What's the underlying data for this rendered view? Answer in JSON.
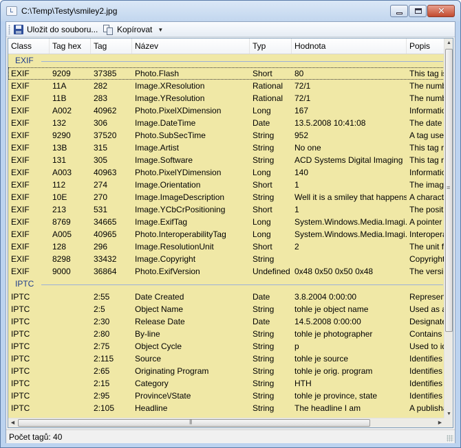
{
  "window": {
    "title": "C:\\Temp\\Testy\\smiley2.jpg"
  },
  "toolbar": {
    "save_label": "Uložit do souboru...",
    "copy_label": "Kopírovat"
  },
  "columns": [
    "Class",
    "Tag hex",
    "Tag",
    "Název",
    "Typ",
    "Hodnota",
    "Popis"
  ],
  "groups": [
    {
      "name": "EXIF",
      "rows": [
        [
          "EXIF",
          "9209",
          "37385",
          "Photo.Flash",
          "Short",
          "80",
          "This tag is"
        ],
        [
          "EXIF",
          "11A",
          "282",
          "Image.XResolution",
          "Rational",
          "72/1",
          "The numbe"
        ],
        [
          "EXIF",
          "11B",
          "283",
          "Image.YResolution",
          "Rational",
          "72/1",
          "The numbe"
        ],
        [
          "EXIF",
          "A002",
          "40962",
          "Photo.PixelXDimension",
          "Long",
          "167",
          "Information"
        ],
        [
          "EXIF",
          "132",
          "306",
          "Image.DateTime",
          "Date",
          "13.5.2008 10:41:08",
          "The date a"
        ],
        [
          "EXIF",
          "9290",
          "37520",
          "Photo.SubSecTime",
          "String",
          "952",
          "A tag used"
        ],
        [
          "EXIF",
          "13B",
          "315",
          "Image.Artist",
          "String",
          "No one",
          "This tag re"
        ],
        [
          "EXIF",
          "131",
          "305",
          "Image.Software",
          "String",
          "ACD Systems Digital Imaging",
          "This tag re"
        ],
        [
          "EXIF",
          "A003",
          "40963",
          "Photo.PixelYDimension",
          "Long",
          "140",
          "Information"
        ],
        [
          "EXIF",
          "112",
          "274",
          "Image.Orientation",
          "Short",
          "1",
          "The image"
        ],
        [
          "EXIF",
          "10E",
          "270",
          "Image.ImageDescription",
          "String",
          "Well it is a smiley that happens...",
          "A characte"
        ],
        [
          "EXIF",
          "213",
          "531",
          "Image.YCbCrPositioning",
          "Short",
          "1",
          "The positio"
        ],
        [
          "EXIF",
          "8769",
          "34665",
          "Image.ExifTag",
          "Long",
          "System.Windows.Media.Imagi...",
          "A pointer to"
        ],
        [
          "EXIF",
          "A005",
          "40965",
          "Photo.InteroperabilityTag",
          "Long",
          "System.Windows.Media.Imagi...",
          "Interopera"
        ],
        [
          "EXIF",
          "128",
          "296",
          "Image.ResolutionUnit",
          "Short",
          "2",
          "The unit fo"
        ],
        [
          "EXIF",
          "8298",
          "33432",
          "Image.Copyright",
          "String",
          "",
          "Copyright i"
        ],
        [
          "EXIF",
          "9000",
          "36864",
          "Photo.ExifVersion",
          "Undefined",
          "0x48 0x50 0x50 0x48",
          "The versio"
        ]
      ]
    },
    {
      "name": "IPTC",
      "rows": [
        [
          "IPTC",
          "",
          "2:55",
          "Date Created",
          "Date",
          "3.8.2004 0:00:00",
          "Represent"
        ],
        [
          "IPTC",
          "",
          "2:5",
          "Object Name",
          "String",
          "tohle je object name",
          "Used as a"
        ],
        [
          "IPTC",
          "",
          "2:30",
          "Release Date",
          "Date",
          "14.5.2008 0:00:00",
          "Designate"
        ],
        [
          "IPTC",
          "",
          "2:80",
          "By-line",
          "String",
          "tohle je photographer",
          "Contains n"
        ],
        [
          "IPTC",
          "",
          "2:75",
          "Object Cycle",
          "String",
          "p",
          "Used to ide"
        ],
        [
          "IPTC",
          "",
          "2:115",
          "Source",
          "String",
          "tohle je source",
          "Identifies t"
        ],
        [
          "IPTC",
          "",
          "2:65",
          "Originating Program",
          "String",
          "tohle je  orig. program",
          "Identifies t"
        ],
        [
          "IPTC",
          "",
          "2:15",
          "Category",
          "String",
          "HTH",
          "Identifies t"
        ],
        [
          "IPTC",
          "",
          "2:95",
          "Province\\/State",
          "String",
          "tohle je province, state",
          "Identifies P"
        ],
        [
          "IPTC",
          "",
          "2:105",
          "Headline",
          "String",
          "The headline I am",
          "A publishal"
        ]
      ]
    }
  ],
  "focused_row": "EXIF-0",
  "status": {
    "text": "Počet tagů: 40"
  },
  "colors": {
    "grid_background": "#f0e8a6",
    "group_header_text": "#1e3c8c"
  }
}
